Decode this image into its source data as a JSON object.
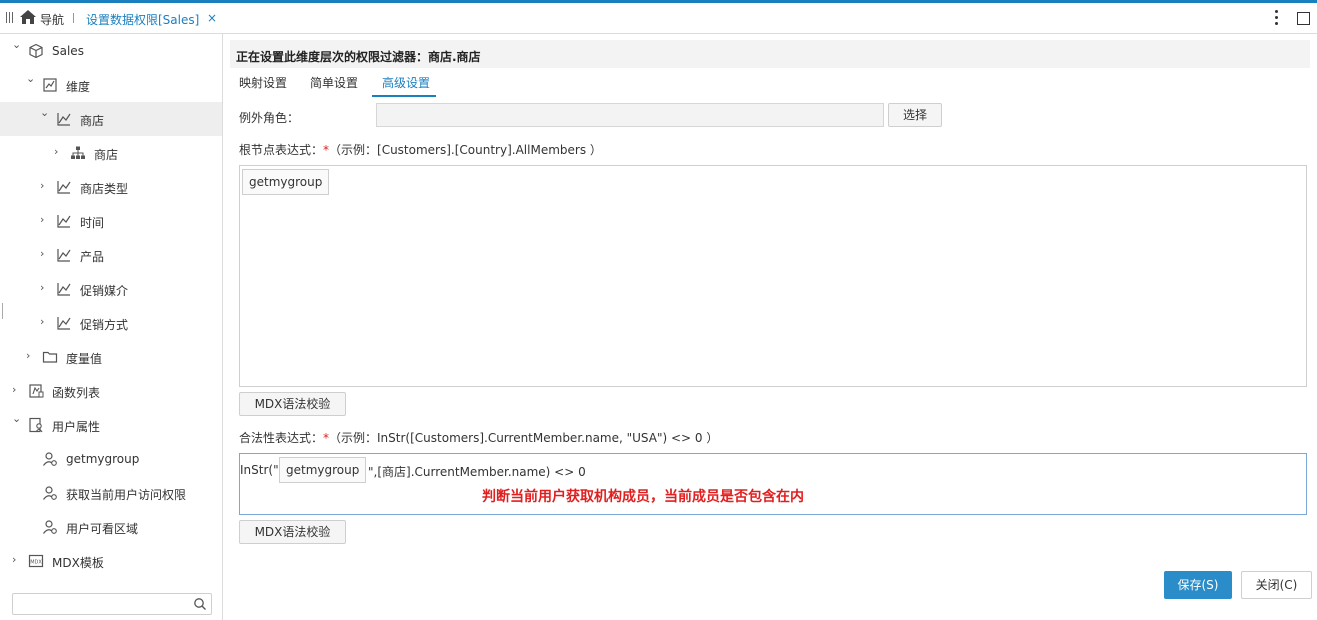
{
  "tabbar": {
    "nav_label": "导航",
    "active_tab": "设置数据权限[Sales]",
    "close_glyph": "×"
  },
  "sidebar": {
    "items": [
      {
        "label": "Sales",
        "icon": "cube-icon",
        "expanded": true
      },
      {
        "label": "维度",
        "icon": "dimension-icon",
        "expanded": true
      },
      {
        "label": "商店",
        "icon": "chart-line-icon",
        "expanded": true,
        "selected": true
      },
      {
        "label": "商店",
        "icon": "hierarchy-icon",
        "expanded": false
      },
      {
        "label": "商店类型",
        "icon": "chart-line-icon",
        "expanded": false
      },
      {
        "label": "时间",
        "icon": "chart-line-icon",
        "expanded": false
      },
      {
        "label": "产品",
        "icon": "chart-line-icon",
        "expanded": false
      },
      {
        "label": "促销媒介",
        "icon": "chart-line-icon",
        "expanded": false
      },
      {
        "label": "促销方式",
        "icon": "chart-line-icon",
        "expanded": false
      },
      {
        "label": "度量值",
        "icon": "folder-icon",
        "expanded": false
      },
      {
        "label": "函数列表",
        "icon": "function-icon",
        "expanded": false
      },
      {
        "label": "用户属性",
        "icon": "user-property-icon",
        "expanded": true
      },
      {
        "label": "getmygroup",
        "icon": "user-gear-icon"
      },
      {
        "label": "获取当前用户访问权限",
        "icon": "user-gear-icon"
      },
      {
        "label": "用户可看区域",
        "icon": "user-gear-icon"
      },
      {
        "label": "MDX模板",
        "icon": "mdx-icon",
        "expanded": false
      }
    ],
    "search_placeholder": ""
  },
  "main": {
    "title": "正在设置此维度层次的权限过滤器：商店.商店",
    "tabs": [
      {
        "label": "映射设置",
        "active": false
      },
      {
        "label": "简单设置",
        "active": false
      },
      {
        "label": "高级设置",
        "active": true
      }
    ],
    "exception_role_label": "例外角色：",
    "exception_role_value": "",
    "select_button": "选择",
    "root_expr_label": "根节点表达式：",
    "required_mark": "*",
    "root_expr_hint": "（示例：[Customers].[Country].AllMembers ）",
    "root_expr_chip": "getmygroup",
    "validate_button": "MDX语法校验",
    "legal_expr_label": "合法性表达式：",
    "legal_expr_hint": "（示例：InStr([Customers].CurrentMember.name, \"USA\") <> 0 ）",
    "legal_expr_prefix": "InStr(\"",
    "legal_expr_chip": "getmygroup",
    "legal_expr_suffix": "\",[商店].CurrentMember.name) <> 0",
    "annotation": "判断当前用户获取机构成员，当前成员是否包含在内",
    "save_button": "保存(S)",
    "close_button": "关闭(C)"
  },
  "colors": {
    "accent": "#1a7fbf",
    "required": "#e02020",
    "save_bg": "#2a8cc8"
  }
}
